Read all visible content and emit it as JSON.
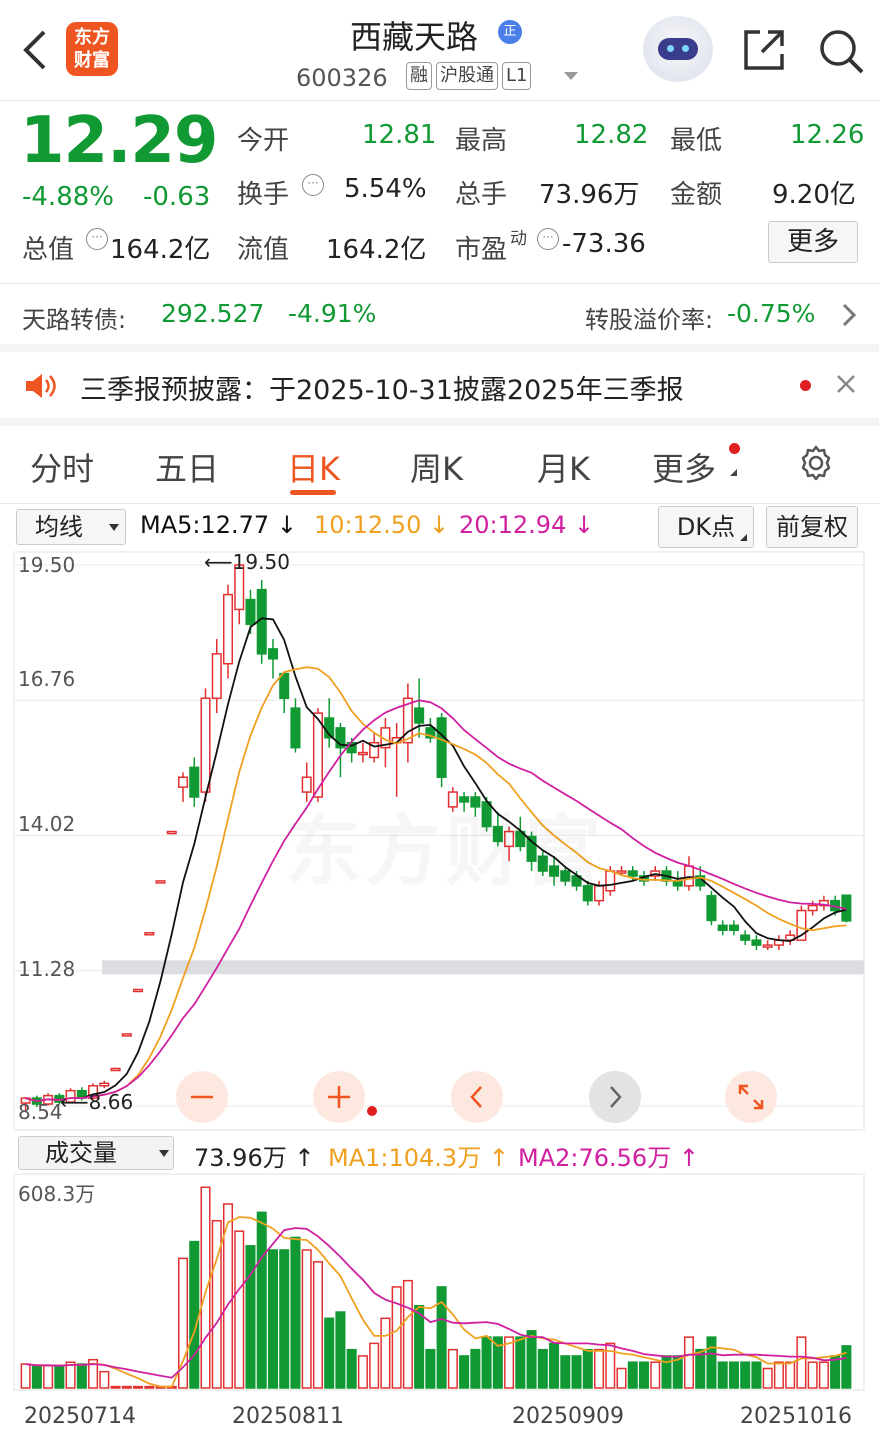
{
  "header": {
    "title": "西藏天路",
    "title_badge": "正",
    "code": "600326",
    "tags": [
      "融",
      "沪股通",
      "L1"
    ],
    "logo_text": "东方\n财富"
  },
  "quote": {
    "price": "12.29",
    "change_pct": "-4.88%",
    "change": "-0.63",
    "rows": [
      [
        {
          "label": "今开",
          "value": "12.81",
          "color": "green"
        },
        {
          "label": "最高",
          "value": "12.82",
          "color": "green"
        },
        {
          "label": "最低",
          "value": "12.26",
          "color": "green"
        }
      ],
      [
        {
          "label": "换手",
          "value": "5.54%",
          "color": "dark"
        },
        {
          "label": "总手",
          "value": "73.96万",
          "color": "dark"
        },
        {
          "label": "金额",
          "value": "9.20亿",
          "color": "dark"
        }
      ],
      [
        {
          "label": "流值",
          "value": "164.2亿",
          "color": "dark"
        },
        {
          "label": "市盈",
          "value": "-73.36",
          "color": "dark"
        }
      ]
    ],
    "total_value_label": "总值",
    "total_value": "164.2亿",
    "pe_sup": "动",
    "more_button": "更多"
  },
  "bond": {
    "label": "天路转债:",
    "price": "292.527",
    "change": "-4.91%",
    "premium_label": "转股溢价率:",
    "premium_value": "-0.75%"
  },
  "notice": {
    "text": "三季报预披露：于2025-10-31披露2025年三季报"
  },
  "tabs": [
    {
      "label": "分时",
      "active": false
    },
    {
      "label": "五日",
      "active": false
    },
    {
      "label": "日K",
      "active": true
    },
    {
      "label": "周K",
      "active": false
    },
    {
      "label": "月K",
      "active": false
    },
    {
      "label": "更多",
      "active": false
    }
  ],
  "ma_bar": {
    "selector": "均线",
    "ma5": "MA5:12.77",
    "ma10": "10:12.50",
    "ma20": "20:12.94",
    "dk_button": "DK点",
    "adjust_button": "前复权",
    "ma5_color": "#111111",
    "ma10_color": "#f0a020",
    "ma20_color": "#d020a0"
  },
  "kline_axis": [
    "19.50",
    "16.76",
    "14.02",
    "11.28",
    "8.54"
  ],
  "kline_marks": {
    "high": "19.50",
    "low": "8.66"
  },
  "watermark": "东方财富",
  "volume_bar": {
    "selector": "成交量",
    "vol": "73.96万",
    "ma1": "MA1:104.3万",
    "ma2": "MA2:76.56万",
    "max_label": "608.3万"
  },
  "dates": [
    "20250714",
    "20250811",
    "20250909",
    "20251016"
  ],
  "colors": {
    "up": "#e23030",
    "down": "#119933"
  },
  "chart_data": {
    "type": "candlestick",
    "ylim": [
      8.54,
      19.5
    ],
    "candles": [
      [
        8.6,
        8.7,
        8.45,
        8.72
      ],
      [
        8.7,
        8.58,
        8.52,
        8.75
      ],
      [
        8.58,
        8.75,
        8.55,
        8.8
      ],
      [
        8.75,
        8.62,
        8.57,
        8.8
      ],
      [
        8.62,
        8.85,
        8.6,
        8.9
      ],
      [
        8.85,
        8.7,
        8.65,
        8.92
      ],
      [
        8.7,
        8.95,
        8.66,
        9.0
      ],
      [
        8.95,
        9.0,
        8.9,
        9.05
      ],
      [
        9.3,
        9.3,
        9.3,
        9.3
      ],
      [
        10.0,
        10.0,
        10.0,
        10.0
      ],
      [
        10.9,
        10.9,
        10.9,
        10.9
      ],
      [
        12.05,
        12.05,
        12.05,
        12.05
      ],
      [
        13.1,
        13.1,
        13.1,
        13.1
      ],
      [
        14.1,
        14.1,
        14.1,
        14.1
      ],
      [
        15.0,
        15.2,
        14.7,
        15.3
      ],
      [
        15.4,
        14.8,
        14.6,
        15.6
      ],
      [
        14.9,
        16.8,
        14.7,
        17.0
      ],
      [
        16.8,
        17.7,
        16.5,
        18.0
      ],
      [
        17.5,
        18.9,
        17.2,
        19.1
      ],
      [
        18.6,
        19.5,
        18.3,
        19.55
      ],
      [
        18.8,
        18.3,
        18.1,
        19.0
      ],
      [
        19.0,
        17.7,
        17.5,
        19.2
      ],
      [
        17.8,
        17.6,
        17.2,
        18.0
      ],
      [
        17.3,
        16.8,
        16.5,
        17.3
      ],
      [
        16.6,
        15.8,
        15.7,
        16.8
      ],
      [
        14.9,
        15.2,
        14.7,
        15.5
      ],
      [
        14.8,
        16.5,
        14.7,
        16.6
      ],
      [
        16.4,
        16.0,
        15.8,
        16.8
      ],
      [
        16.2,
        15.8,
        15.2,
        16.3
      ],
      [
        15.9,
        15.7,
        15.5,
        16.0
      ],
      [
        15.7,
        15.7,
        15.5,
        15.9
      ],
      [
        15.6,
        15.9,
        15.5,
        16.1
      ],
      [
        15.8,
        16.2,
        15.4,
        16.4
      ],
      [
        15.9,
        16.0,
        14.8,
        16.3
      ],
      [
        15.9,
        16.8,
        15.5,
        17.1
      ],
      [
        16.6,
        16.3,
        16.0,
        17.2
      ],
      [
        16.2,
        16.0,
        15.9,
        16.4
      ],
      [
        16.4,
        15.2,
        15.0,
        16.5
      ],
      [
        14.6,
        14.9,
        14.5,
        15.0
      ],
      [
        14.8,
        14.7,
        14.5,
        14.9
      ],
      [
        14.8,
        14.6,
        14.4,
        14.9
      ],
      [
        14.7,
        14.2,
        14.1,
        14.8
      ],
      [
        14.2,
        13.9,
        13.8,
        14.5
      ],
      [
        13.8,
        14.1,
        13.5,
        14.2
      ],
      [
        14.1,
        13.8,
        13.7,
        14.4
      ],
      [
        14.0,
        13.5,
        13.3,
        14.1
      ],
      [
        13.6,
        13.3,
        13.2,
        13.7
      ],
      [
        13.4,
        13.2,
        13.0,
        13.6
      ],
      [
        13.3,
        13.1,
        13.0,
        13.4
      ],
      [
        13.2,
        13.0,
        12.9,
        13.3
      ],
      [
        13.0,
        12.7,
        12.6,
        13.1
      ],
      [
        12.7,
        13.0,
        12.6,
        13.1
      ],
      [
        12.9,
        13.3,
        12.8,
        13.4
      ],
      [
        13.3,
        13.3,
        13.2,
        13.4
      ],
      [
        13.3,
        13.2,
        13.1,
        13.4
      ],
      [
        13.2,
        13.1,
        13.0,
        13.3
      ],
      [
        13.2,
        13.3,
        13.1,
        13.4
      ],
      [
        13.3,
        13.1,
        13.0,
        13.4
      ],
      [
        13.1,
        13.0,
        12.9,
        13.3
      ],
      [
        13.0,
        13.4,
        12.9,
        13.6
      ],
      [
        13.2,
        13.0,
        12.9,
        13.4
      ],
      [
        12.8,
        12.3,
        12.2,
        12.9
      ],
      [
        12.2,
        12.1,
        12.0,
        12.3
      ],
      [
        12.2,
        12.1,
        12.0,
        12.3
      ],
      [
        12.0,
        11.9,
        11.8,
        12.1
      ],
      [
        11.9,
        11.8,
        11.7,
        12.0
      ],
      [
        11.8,
        11.8,
        11.7,
        11.9
      ],
      [
        11.8,
        11.9,
        11.7,
        12.0
      ],
      [
        11.9,
        12.0,
        11.8,
        12.1
      ],
      [
        11.9,
        12.5,
        11.9,
        12.6
      ],
      [
        12.5,
        12.6,
        12.4,
        12.7
      ],
      [
        12.6,
        12.7,
        12.5,
        12.8
      ],
      [
        12.7,
        12.5,
        12.4,
        12.8
      ],
      [
        12.81,
        12.29,
        12.26,
        12.82
      ]
    ],
    "ma5_label": "MA5",
    "ma10_label": "10",
    "ma20_label": "20",
    "volume_ylim": [
      0,
      608.3
    ],
    "volume_unit": "万"
  }
}
